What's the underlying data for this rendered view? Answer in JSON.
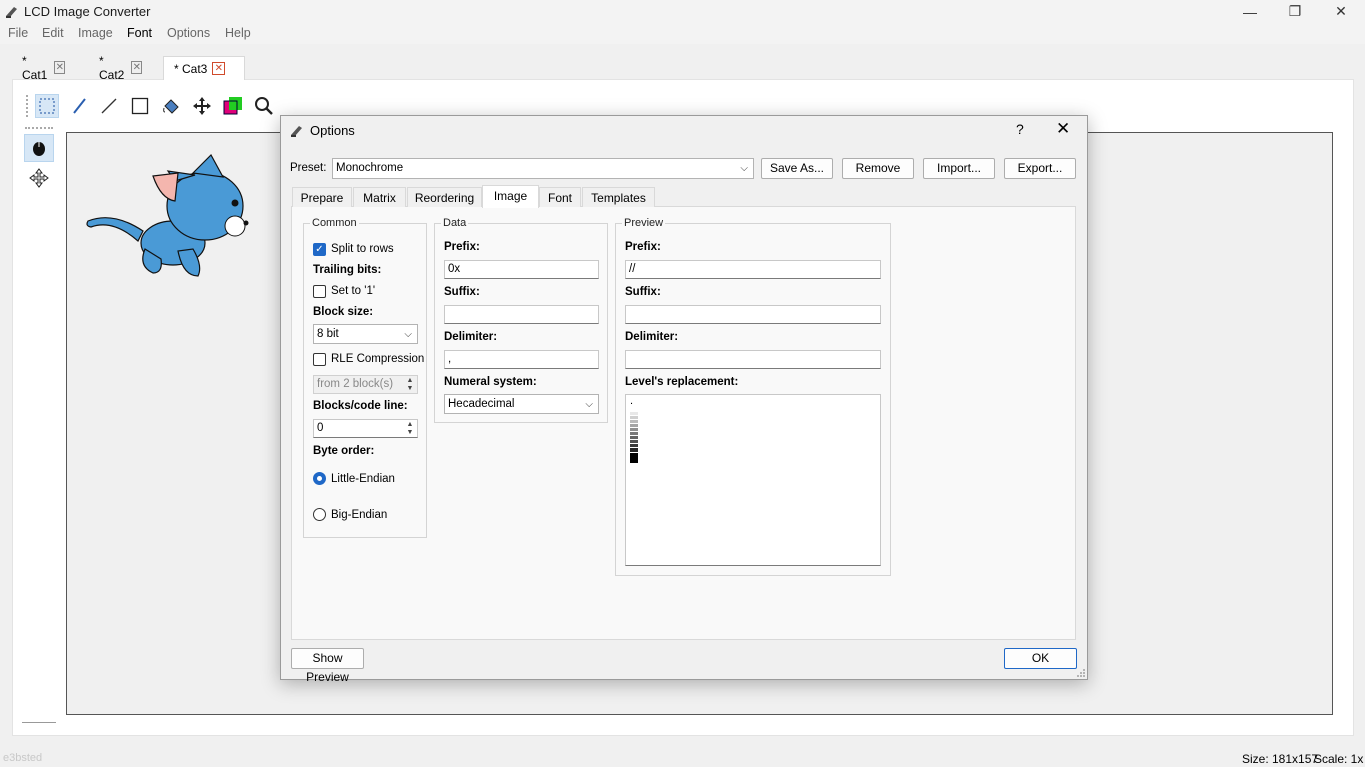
{
  "window": {
    "title": "LCD Image Converter",
    "minimize": "—",
    "maximize": "❐",
    "close": "✕"
  },
  "menu": [
    "File",
    "Edit",
    "Image",
    "Font",
    "Options",
    "Help"
  ],
  "doc_tabs": [
    {
      "label": "* Cat1"
    },
    {
      "label": "* Cat2"
    },
    {
      "label": "* Cat3"
    }
  ],
  "status": {
    "size": "Size: 181x157",
    "scale": "Scale: 1x",
    "ghost": "e3bsted"
  },
  "dialog": {
    "title": "Options",
    "help": "?",
    "close": "✕",
    "preset_label": "Preset:",
    "preset_value": "Monochrome",
    "buttons": {
      "save_as": "Save As...",
      "remove": "Remove",
      "import": "Import...",
      "export": "Export...",
      "show_preview": "Show Preview",
      "ok": "OK"
    },
    "tabs": [
      "Prepare",
      "Matrix",
      "Reordering",
      "Image",
      "Font",
      "Templates"
    ],
    "selected_tab": "Image",
    "common": {
      "title": "Common",
      "split_to_rows": "Split to rows",
      "split_to_rows_checked": true,
      "trailing_bits": "Trailing bits:",
      "set_to_1": "Set to '1'",
      "set_to_1_checked": false,
      "block_size_label": "Block size:",
      "block_size": "8 bit",
      "rle_compression": "RLE Compression",
      "rle_checked": false,
      "rle_from": "from 2 block(s)",
      "blocks_per_line_label": "Blocks/code line:",
      "blocks_per_line": "0",
      "byte_order_label": "Byte order:",
      "little_endian": "Little-Endian",
      "big_endian": "Big-Endian",
      "byte_order_selected": "Little-Endian"
    },
    "data": {
      "title": "Data",
      "prefix_label": "Prefix:",
      "prefix": "0x",
      "suffix_label": "Suffix:",
      "suffix": "",
      "delimiter_label": "Delimiter:",
      "delimiter": ",",
      "numeral_label": "Numeral system:",
      "numeral": "Hecadecimal"
    },
    "preview": {
      "title": "Preview",
      "prefix_label": "Prefix:",
      "prefix": "//",
      "suffix_label": "Suffix:",
      "suffix": "",
      "delimiter_label": "Delimiter:",
      "delimiter": "",
      "levels_label": "Level's replacement:",
      "levels_first": "."
    }
  },
  "colors": {
    "accent": "#1f68c7",
    "close_red": "#d04a2b",
    "cat_blue": "#4a9ad6"
  }
}
